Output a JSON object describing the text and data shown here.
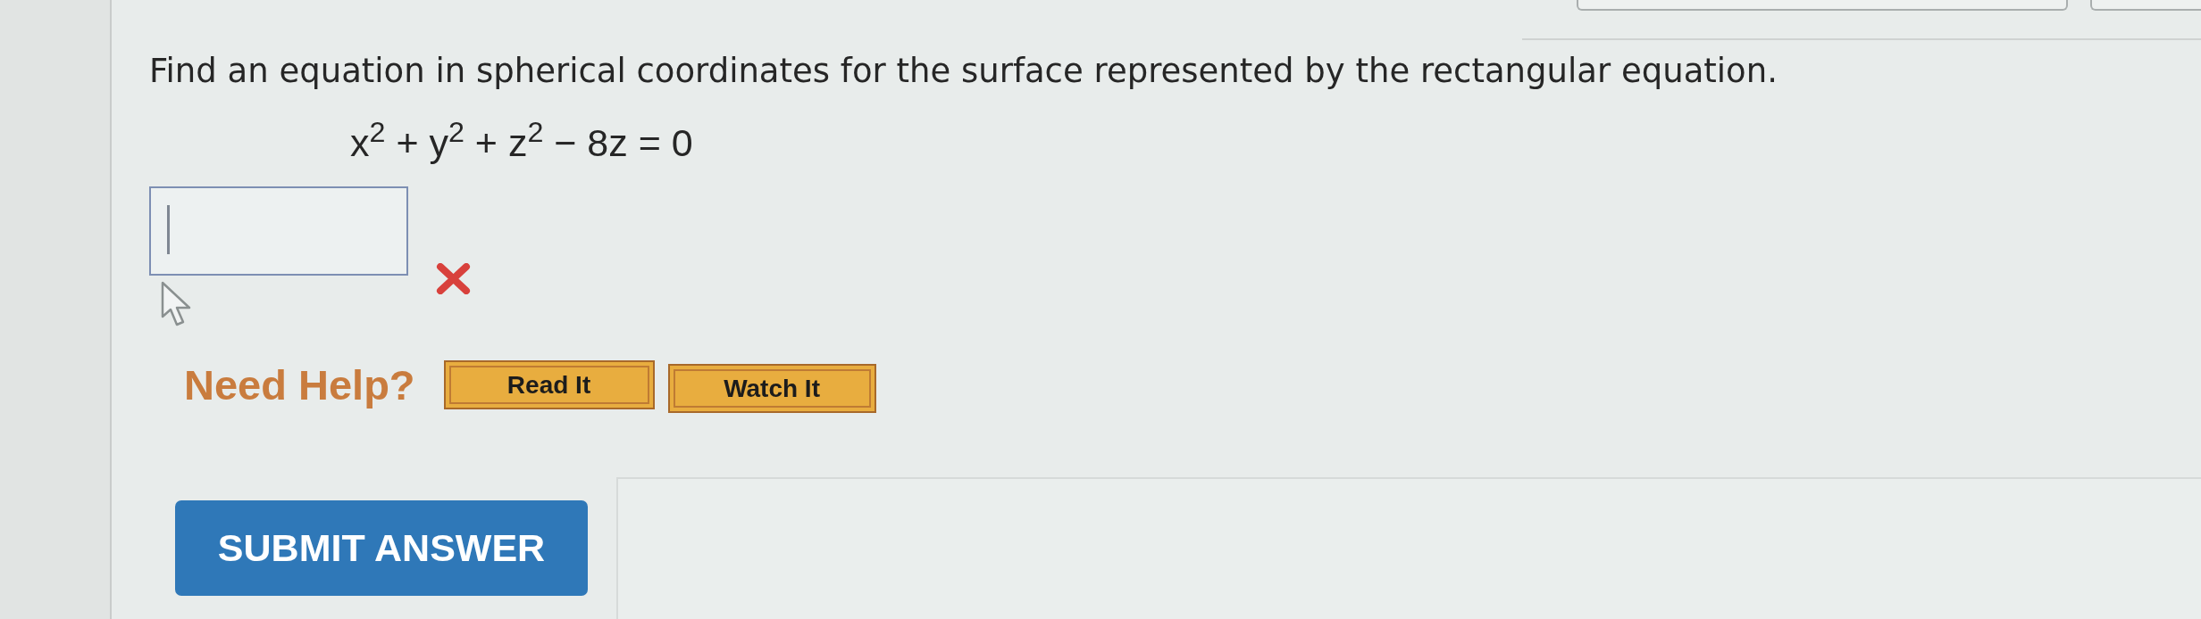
{
  "question": {
    "prompt": "Find an equation in spherical coordinates for the surface represented by the rectangular equation.",
    "equation": "x$^{2}$ + y$^{2}$ + z$^{2}$ − 8z = 0"
  },
  "answer": {
    "focused": true,
    "marked_incorrect": true
  },
  "help": {
    "label": "Need Help?",
    "buttons": [
      "Read It",
      "Watch It"
    ]
  },
  "submit": {
    "label": "SUBMIT ANSWER"
  }
}
